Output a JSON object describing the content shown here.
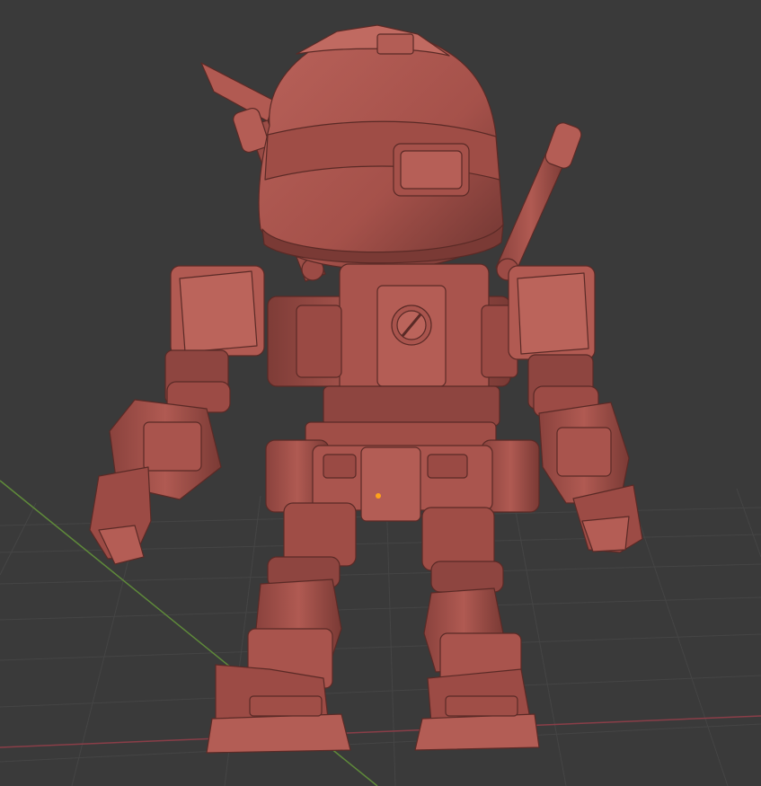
{
  "viewport": {
    "background": "#3a3a3a",
    "grid_color": "#454545",
    "x_axis_color": "#8a3e48",
    "y_axis_color": "#5f8a3a",
    "origin_color": "#ffa21a"
  },
  "model": {
    "name": "chibi-robot-mech",
    "view": "back",
    "base_color": "#a5514a",
    "shadow_color": "#6e3531",
    "highlight_color": "#c26a60"
  }
}
